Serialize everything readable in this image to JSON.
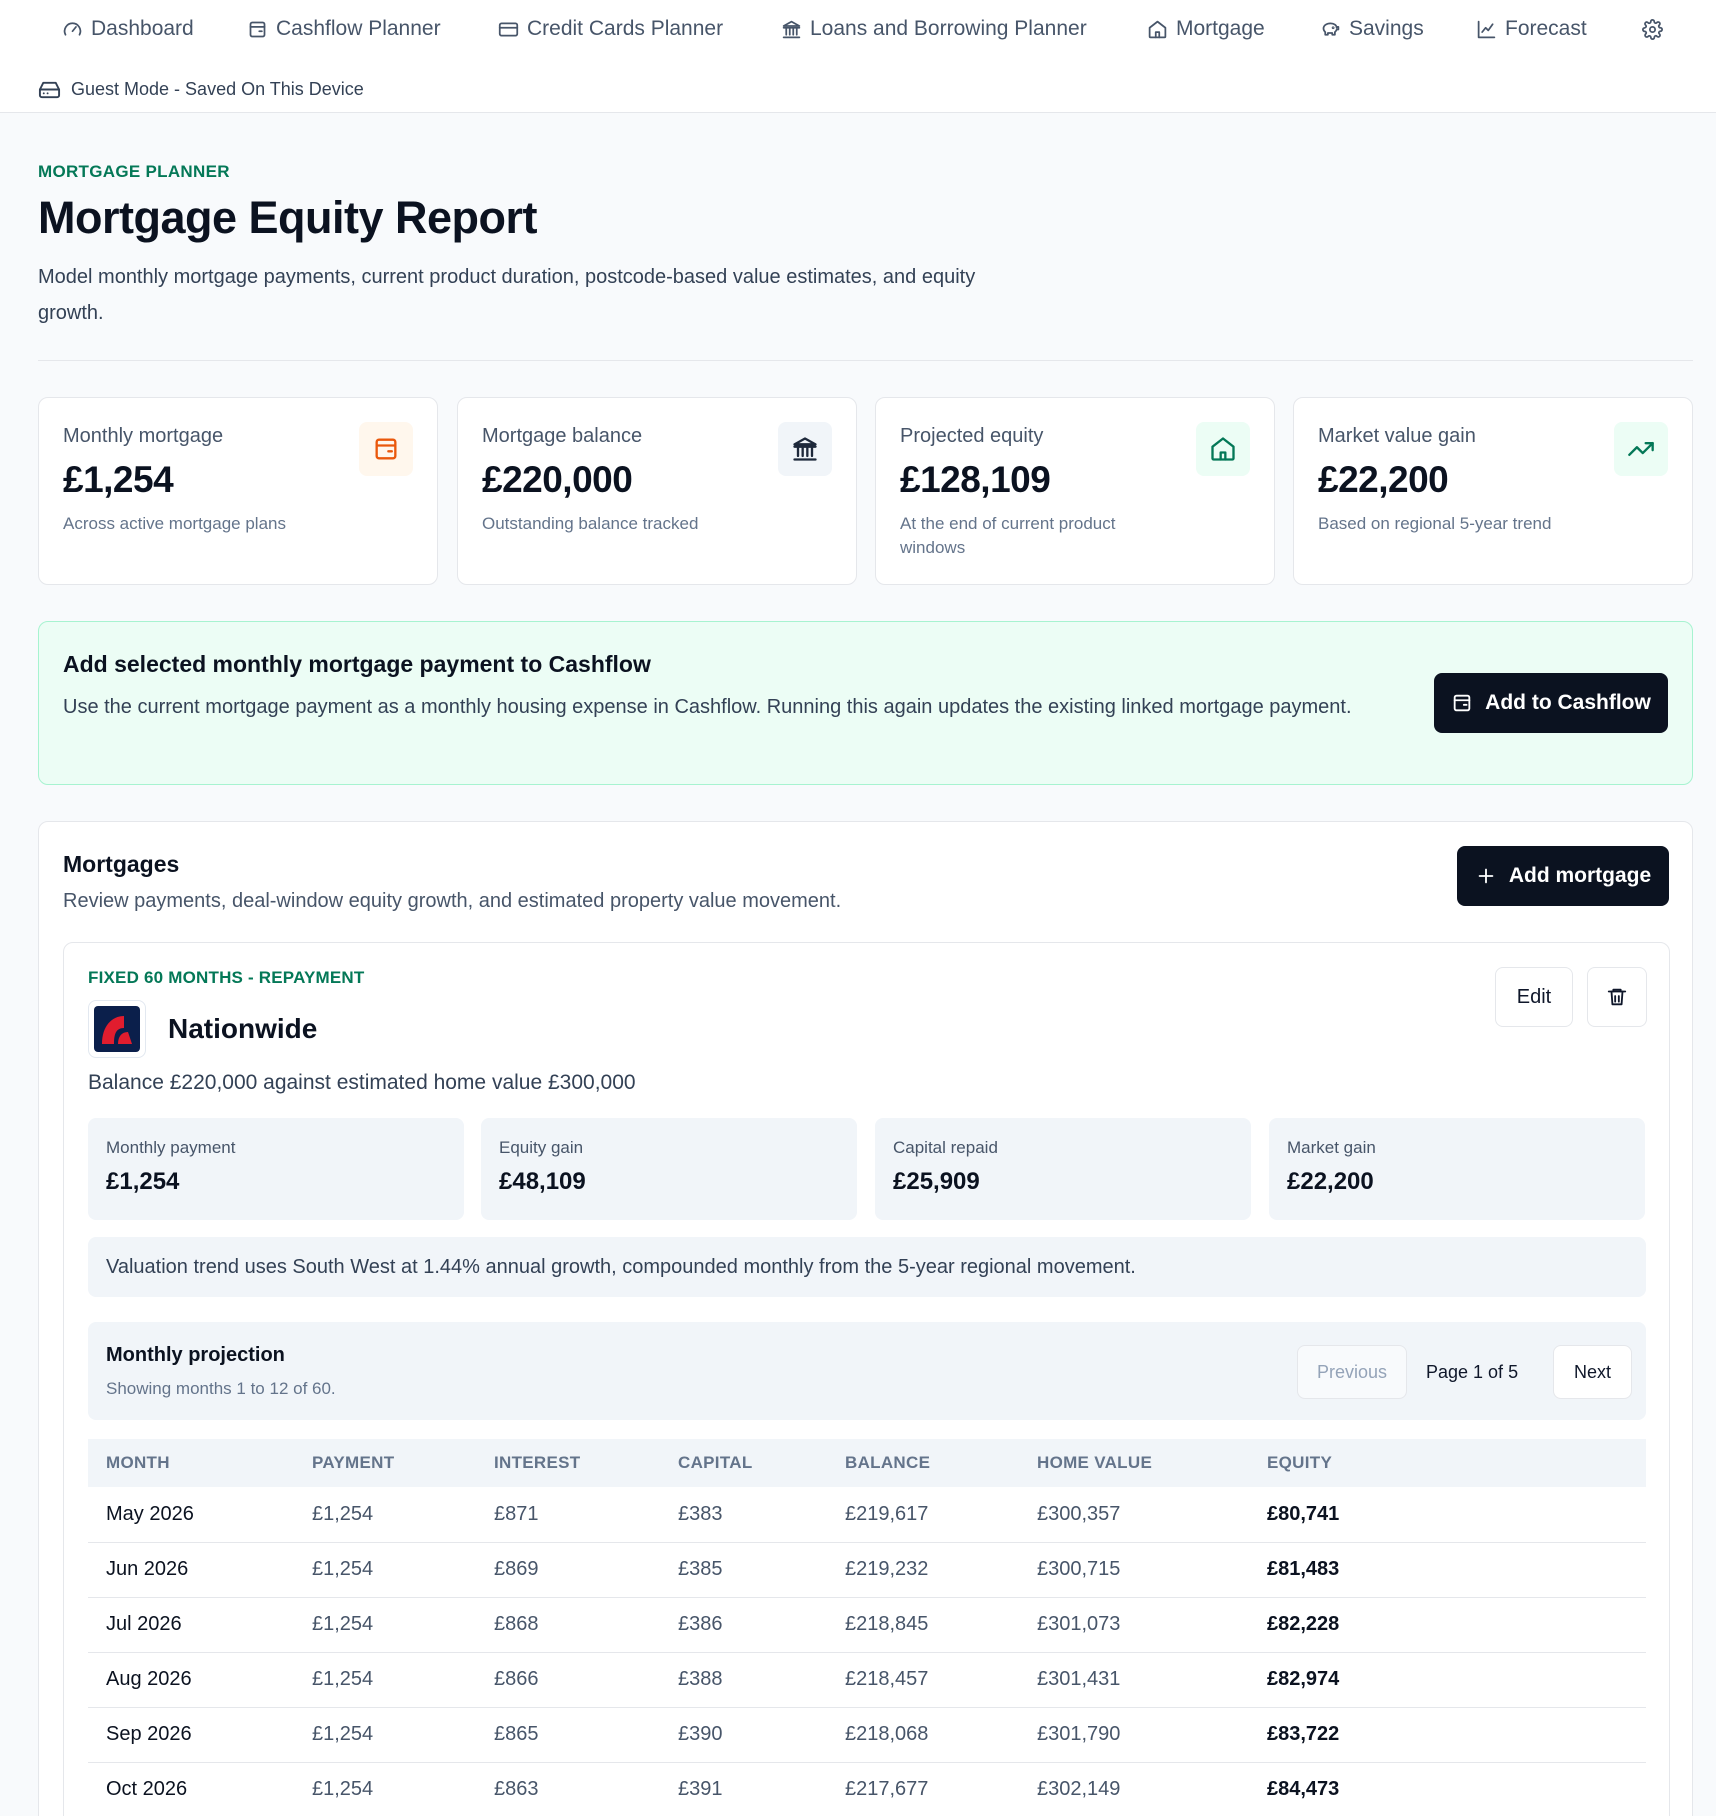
{
  "nav": {
    "items": [
      {
        "label": "Dashboard",
        "icon": "gauge-icon"
      },
      {
        "label": "Cashflow Planner",
        "icon": "wallet-icon"
      },
      {
        "label": "Credit Cards Planner",
        "icon": "credit-card-icon"
      },
      {
        "label": "Loans and Borrowing Planner",
        "icon": "bank-icon"
      },
      {
        "label": "Mortgage",
        "icon": "home-icon"
      },
      {
        "label": "Savings",
        "icon": "piggy-bank-icon"
      },
      {
        "label": "Forecast",
        "icon": "line-chart-icon"
      }
    ],
    "settings_icon": "gear-icon",
    "guest_mode": "Guest Mode - Saved On This Device"
  },
  "header": {
    "eyebrow": "MORTGAGE PLANNER",
    "title": "Mortgage Equity Report",
    "description": "Model monthly mortgage payments, current product duration, postcode-based value estimates, and equity growth."
  },
  "stats": [
    {
      "label": "Monthly mortgage",
      "value": "£1,254",
      "sub": "Across active mortgage plans",
      "icon": "wallet-icon",
      "accent": "#ea580c",
      "bg": "#fff7ed"
    },
    {
      "label": "Mortgage balance",
      "value": "£220,000",
      "sub": "Outstanding balance tracked",
      "icon": "bank-icon",
      "accent": "#1e293b",
      "bg": "#f1f5f9"
    },
    {
      "label": "Projected equity",
      "value": "£128,109",
      "sub": "At the end of current product windows",
      "icon": "home-icon",
      "accent": "#047857",
      "bg": "#ecfdf5"
    },
    {
      "label": "Market value gain",
      "value": "£22,200",
      "sub": "Based on regional 5-year trend",
      "icon": "trending-up-icon",
      "accent": "#047857",
      "bg": "#ecfdf5"
    }
  ],
  "banner": {
    "title": "Add selected monthly mortgage payment to Cashflow",
    "description": "Use the current mortgage payment as a monthly housing expense in Cashflow. Running this again updates the existing linked mortgage payment.",
    "button": "Add to Cashflow"
  },
  "mortgages": {
    "title": "Mortgages",
    "description": "Review payments, deal-window equity growth, and estimated property value movement.",
    "add_button": "Add mortgage",
    "card": {
      "product_type": "FIXED 60 MONTHS - REPAYMENT",
      "lender": "Nationwide",
      "balance_line": "Balance £220,000 against estimated home value £300,000",
      "edit_button": "Edit",
      "metrics": [
        {
          "label": "Monthly payment",
          "value": "£1,254"
        },
        {
          "label": "Equity gain",
          "value": "£48,109"
        },
        {
          "label": "Capital repaid",
          "value": "£25,909"
        },
        {
          "label": "Market gain",
          "value": "£22,200"
        }
      ],
      "note": "Valuation trend uses South West at 1.44% annual growth, compounded monthly from the 5-year regional movement.",
      "projection": {
        "title": "Monthly projection",
        "subtitle": "Showing months 1 to 12 of 60.",
        "prev": "Previous",
        "page": "Page 1 of 5",
        "next": "Next",
        "columns": [
          "MONTH",
          "PAYMENT",
          "INTEREST",
          "CAPITAL",
          "BALANCE",
          "HOME VALUE",
          "EQUITY"
        ],
        "rows": [
          [
            "May 2026",
            "£1,254",
            "£871",
            "£383",
            "£219,617",
            "£300,357",
            "£80,741"
          ],
          [
            "Jun 2026",
            "£1,254",
            "£869",
            "£385",
            "£219,232",
            "£300,715",
            "£81,483"
          ],
          [
            "Jul 2026",
            "£1,254",
            "£868",
            "£386",
            "£218,845",
            "£301,073",
            "£82,228"
          ],
          [
            "Aug 2026",
            "£1,254",
            "£866",
            "£388",
            "£218,457",
            "£301,431",
            "£82,974"
          ],
          [
            "Sep 2026",
            "£1,254",
            "£865",
            "£390",
            "£218,068",
            "£301,790",
            "£83,722"
          ],
          [
            "Oct 2026",
            "£1,254",
            "£863",
            "£391",
            "£217,677",
            "£302,149",
            "£84,473"
          ]
        ]
      }
    }
  }
}
